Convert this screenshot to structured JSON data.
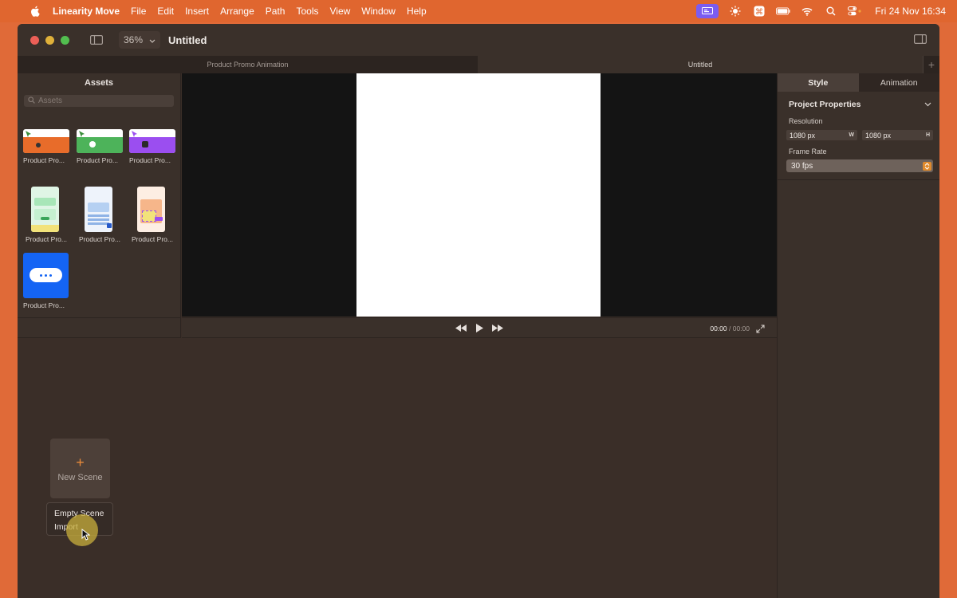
{
  "menubar": {
    "app_name": "Linearity Move",
    "menus": [
      "File",
      "Edit",
      "Insert",
      "Arrange",
      "Path",
      "Tools",
      "View",
      "Window",
      "Help"
    ],
    "clock": "Fri 24 Nov  16:34"
  },
  "titlebar": {
    "zoom": "36%",
    "document_title": "Untitled"
  },
  "tabs": [
    {
      "label": "Product Promo Animation"
    },
    {
      "label": "Untitled"
    }
  ],
  "tab_add": "+",
  "assets": {
    "title": "Assets",
    "search_placeholder": "Assets",
    "items": [
      {
        "label": "Product Pro...",
        "color": "#e86c2a"
      },
      {
        "label": "Product Pro...",
        "color": "#4db35a"
      },
      {
        "label": "Product Pro...",
        "color": "#9b4ef0"
      },
      {
        "label": "Product Pro...",
        "color": "#a8e6b8"
      },
      {
        "label": "Product Pro...",
        "color": "#b5d0f2"
      },
      {
        "label": "Product Pro...",
        "color": "#f6b68a"
      },
      {
        "label": "Product Pro...",
        "color": "#1464f4"
      }
    ]
  },
  "inspector": {
    "tabs": [
      "Style",
      "Animation"
    ],
    "section_title": "Project Properties",
    "resolution_label": "Resolution",
    "width_value": "1080 px",
    "width_unit": "W",
    "height_value": "1080 px",
    "height_unit": "H",
    "frame_rate_label": "Frame Rate",
    "frame_rate_value": "30 fps"
  },
  "playback": {
    "current_time": "00:00",
    "total_time": "/ 00:00"
  },
  "scenes": {
    "new_scene_plus": "+",
    "new_scene_label": "New Scene",
    "menu_items": [
      "Empty Scene",
      "Import"
    ]
  }
}
